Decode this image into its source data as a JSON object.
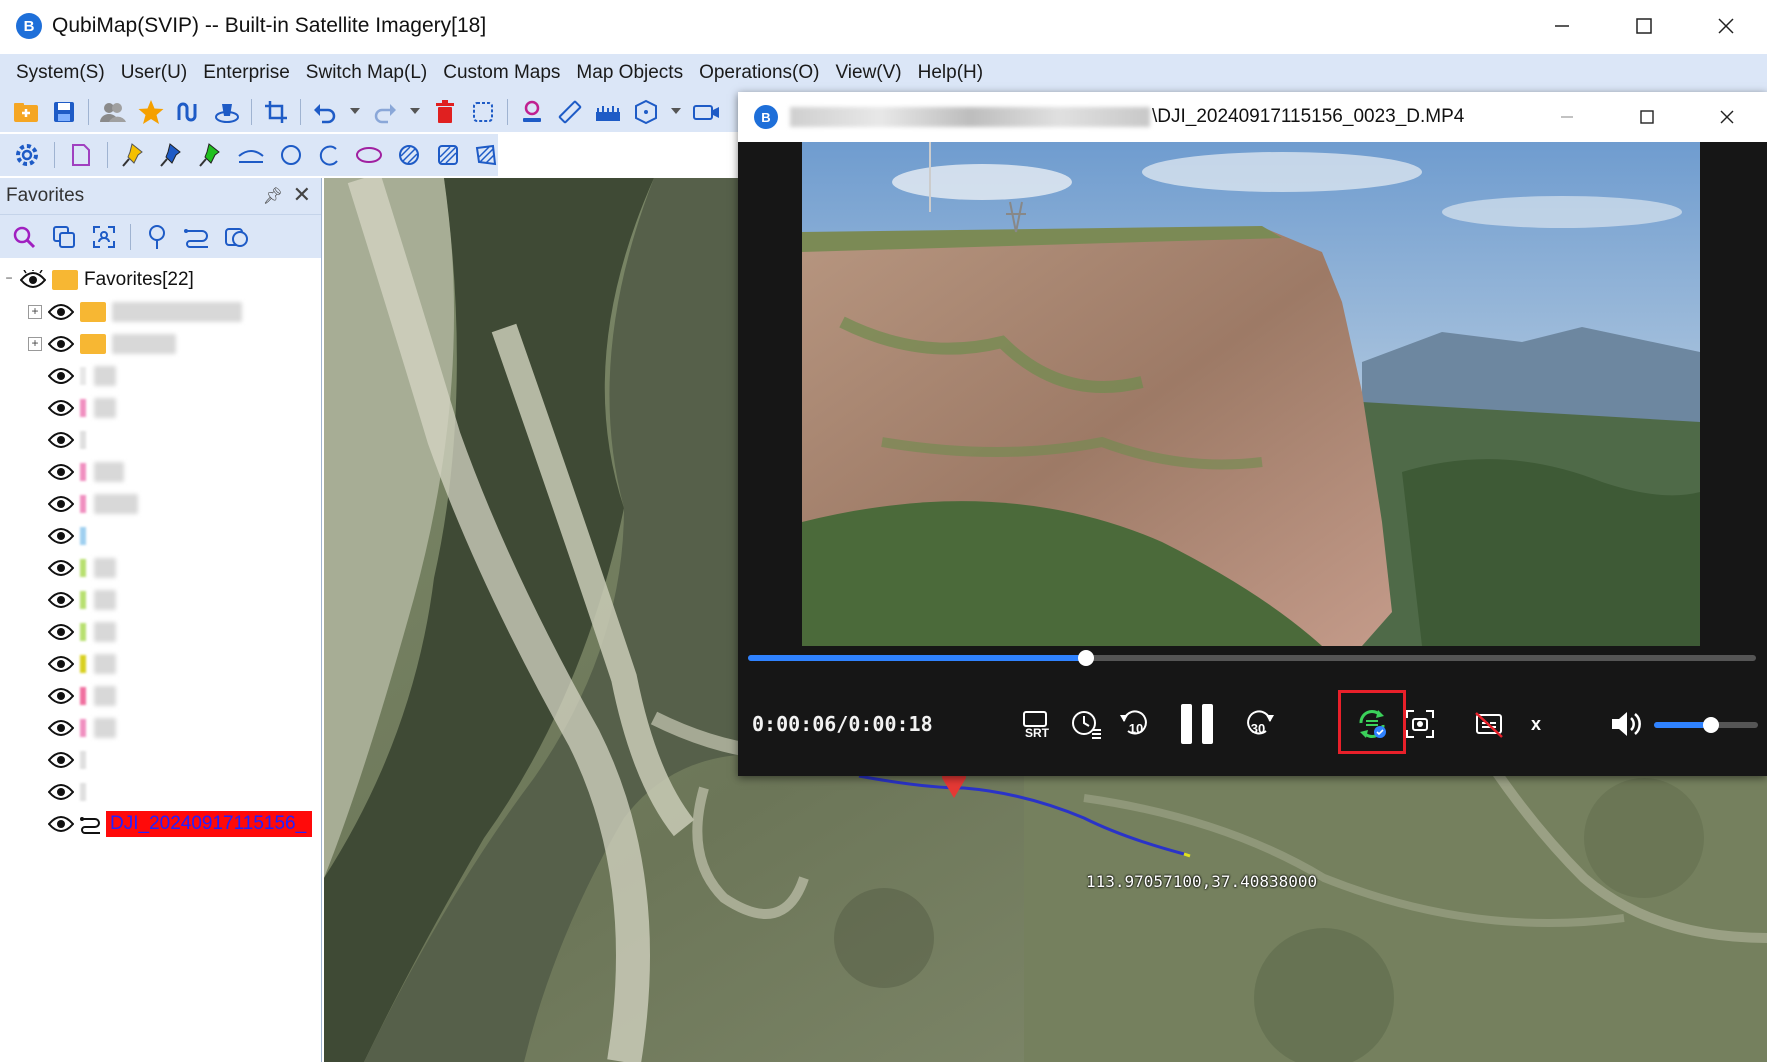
{
  "window": {
    "title": "QubiMap(SVIP) -- Built-in Satellite Imagery[18]",
    "logo_letter": "B",
    "controls": [
      "minimize",
      "maximize",
      "close"
    ]
  },
  "menu": {
    "items": [
      "System(S)",
      "User(U)",
      "Enterprise",
      "Switch Map(L)",
      "Custom Maps",
      "Map Objects",
      "Operations(O)",
      "View(V)",
      "Help(H)"
    ]
  },
  "toolbar1": {
    "icons": [
      "open-folder-icon",
      "save-icon",
      "users-icon",
      "star-icon",
      "route-icon",
      "layers-3d-icon",
      "crop-icon",
      "undo-icon",
      "redo-icon",
      "delete-icon",
      "select-region-icon",
      "place-marker-icon",
      "ruler-icon",
      "measure-area-icon",
      "polyhedron-icon",
      "camera-icon"
    ]
  },
  "toolbar2": {
    "icons": [
      "settings-icon",
      "page-icon",
      "yellow-pin-icon",
      "blue-pin-icon",
      "green-pin-icon",
      "arc-icon",
      "circle-icon",
      "arc-open-icon",
      "ellipse-icon",
      "hatched-circle-icon",
      "hatched-square-icon",
      "hatched-poly-icon"
    ]
  },
  "favorites": {
    "header": "Favorites",
    "root_label": "Favorites[22]",
    "selected_label": "DJI_20240917115156_",
    "rows": [
      {
        "type": "folder",
        "expand": "+",
        "blur_w": 130
      },
      {
        "type": "folder",
        "expand": "+",
        "blur_w": 64
      },
      {
        "type": "item",
        "color": "#e8e8e8",
        "blur_w": 22
      },
      {
        "type": "item",
        "color": "#f090c0",
        "blur_w": 22
      },
      {
        "type": "item",
        "color": "#e0e0e0",
        "blur_w": 0
      },
      {
        "type": "item",
        "color": "#f090c0",
        "blur_w": 30
      },
      {
        "type": "item",
        "color": "#f090c0",
        "blur_w": 44
      },
      {
        "type": "item",
        "color": "#9fd0f0",
        "blur_w": 0
      },
      {
        "type": "item",
        "color": "#b8e070",
        "blur_w": 22
      },
      {
        "type": "item",
        "color": "#b8e070",
        "blur_w": 22
      },
      {
        "type": "item",
        "color": "#b8e070",
        "blur_w": 22
      },
      {
        "type": "item",
        "color": "#d8d020",
        "blur_w": 22
      },
      {
        "type": "item",
        "color": "#f070a0",
        "blur_w": 22
      },
      {
        "type": "item",
        "color": "#f090c0",
        "blur_w": 22
      },
      {
        "type": "item",
        "color": "#e0e0e0",
        "blur_w": 0
      },
      {
        "type": "item",
        "color": "#e0e0e0",
        "blur_w": 0
      }
    ]
  },
  "video": {
    "path_suffix": "\\DJI_20240917115156_0023_D.MP4",
    "time": "0:00:06/0:00:18",
    "progress": 0.335,
    "volume": 0.55,
    "skip_back_label": "10",
    "skip_fwd_label": "30",
    "srt_label": "SRT",
    "close_label": "x"
  },
  "map": {
    "coordinate": "113.97057100,37.40838000"
  }
}
